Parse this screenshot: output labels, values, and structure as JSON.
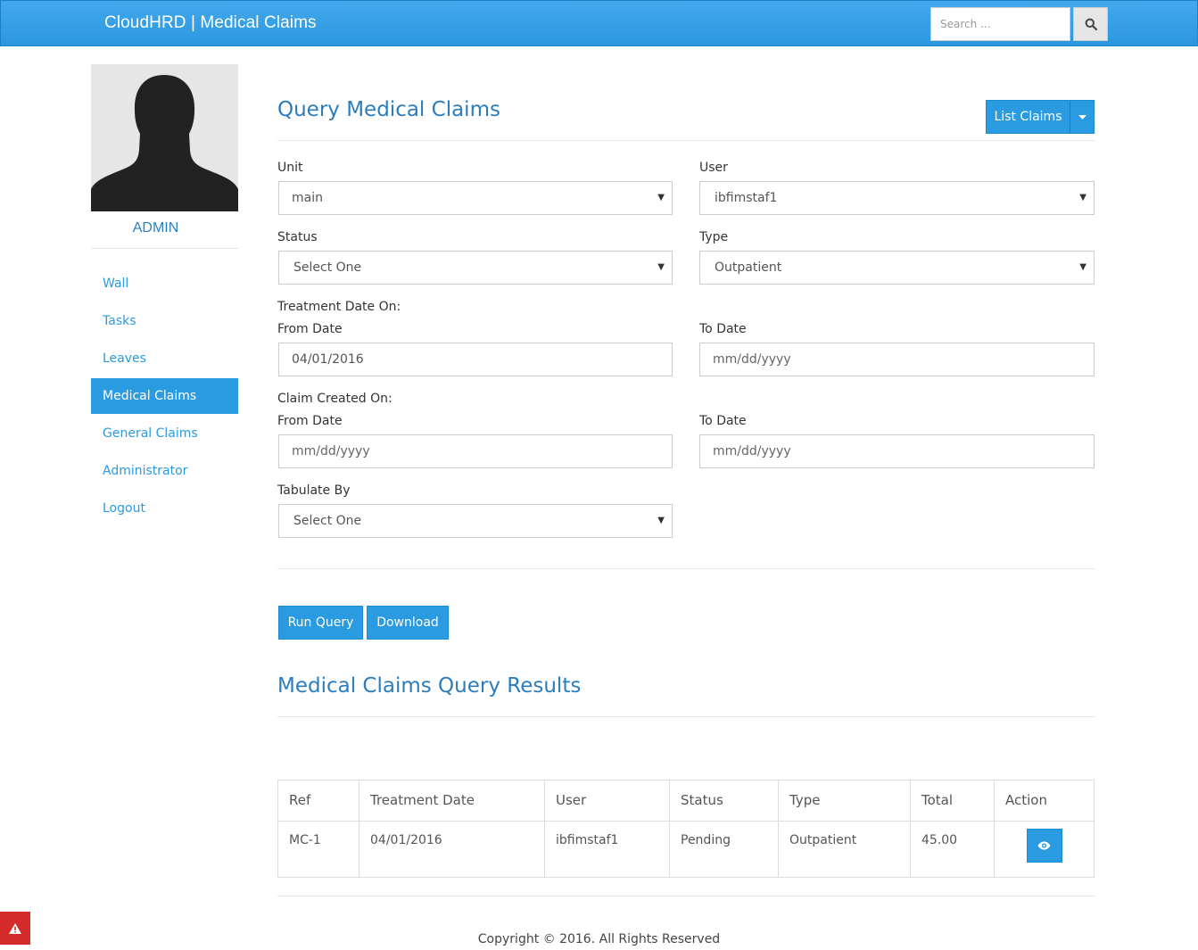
{
  "header": {
    "brand": "CloudHRD | Medical Claims",
    "search_placeholder": "Search ..."
  },
  "sidebar": {
    "user_name": "ADMIN",
    "items": [
      {
        "label": "Wall"
      },
      {
        "label": "Tasks"
      },
      {
        "label": "Leaves"
      },
      {
        "label": "Medical Claims",
        "active": true
      },
      {
        "label": "General Claims"
      },
      {
        "label": "Administrator"
      },
      {
        "label": "Logout"
      }
    ]
  },
  "main": {
    "title": "Query Medical Claims",
    "list_button": "List Claims",
    "form": {
      "unit": {
        "label": "Unit",
        "value": "main"
      },
      "user": {
        "label": "User",
        "value": "ibfimstaf1"
      },
      "status": {
        "label": "Status",
        "value": "Select One"
      },
      "type": {
        "label": "Type",
        "value": "Outpatient"
      },
      "treatment_heading": "Treatment Date On:",
      "treatment_from": {
        "label": "From Date",
        "value": "04/01/2016"
      },
      "treatment_to": {
        "label": "To Date",
        "value": "mm/dd/yyyy"
      },
      "created_heading": "Claim Created On:",
      "created_from": {
        "label": "From Date",
        "value": "mm/dd/yyyy"
      },
      "created_to": {
        "label": "To Date",
        "value": "mm/dd/yyyy"
      },
      "tabulate": {
        "label": "Tabulate By",
        "value": "Select One"
      }
    },
    "buttons": {
      "run": "Run Query",
      "download": "Download"
    },
    "results_title": "Medical Claims Query Results",
    "table": {
      "columns": [
        "Ref",
        "Treatment Date",
        "User",
        "Status",
        "Type",
        "Total",
        "Action"
      ],
      "rows": [
        [
          "MC-1",
          "04/01/2016",
          "ibfimstaf1",
          "Pending",
          "Outpatient",
          "45.00"
        ]
      ]
    }
  },
  "footer": "Copyright © 2016. All Rights Reserved",
  "colors": {
    "primary": "#2a9be0",
    "title": "#2b7dbe",
    "danger": "#d42a2a"
  }
}
